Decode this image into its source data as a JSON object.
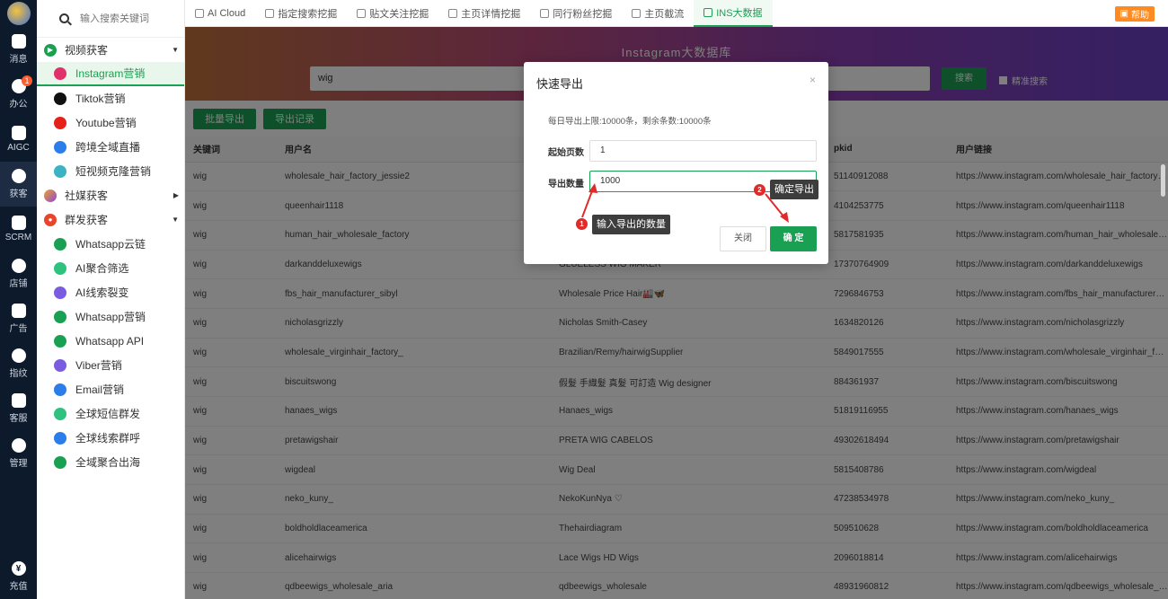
{
  "rail": {
    "badge": "1",
    "items": [
      {
        "label": "消息",
        "icon": "chat-icon"
      },
      {
        "label": "办公",
        "icon": "office-icon"
      },
      {
        "label": "AIGC",
        "icon": "aigc-icon"
      },
      {
        "label": "获客",
        "icon": "user-acquire-icon"
      },
      {
        "label": "SCRM",
        "icon": "scrm-icon"
      },
      {
        "label": "店铺",
        "icon": "store-icon"
      },
      {
        "label": "广告",
        "icon": "ads-icon"
      },
      {
        "label": "指纹",
        "icon": "fingerprint-icon"
      },
      {
        "label": "客服",
        "icon": "service-icon"
      },
      {
        "label": "管理",
        "icon": "grid-icon"
      }
    ],
    "bottom": {
      "label": "充值",
      "icon": "recharge-icon"
    }
  },
  "sidebar": {
    "search_placeholder": "输入搜索关键词",
    "group_video": "视频获客",
    "group_social": "社媒获客",
    "group_mass": "群发获客",
    "video_items": [
      "Instagram营销",
      "Tiktok营销",
      "Youtube营销",
      "跨境全域直播",
      "短视频克隆营销"
    ],
    "mass_items": [
      "Whatsapp云链",
      "AI聚合筛选",
      "AI线索裂变",
      "Whatsapp营销",
      "Whatsapp API",
      "Viber营销",
      "Email营销",
      "全球短信群发",
      "全球线索群呼",
      "全域聚合出海"
    ]
  },
  "tabs": [
    "AI Cloud",
    "指定搜索挖掘",
    "贴文关注挖掘",
    "主页详情挖掘",
    "同行粉丝挖掘",
    "主页截流",
    "INS大数据"
  ],
  "help_label": "帮助",
  "banner": {
    "title": "Instagram大数据库",
    "search_value": "wig",
    "search_button": "搜索",
    "precise_label": "精准搜索"
  },
  "actions": {
    "batch_export": "批量导出",
    "export_records": "导出记录"
  },
  "table": {
    "headers": [
      "关键词",
      "用户名",
      "",
      "pkid",
      "用户链接"
    ],
    "rows": [
      [
        "wig",
        "wholesale_hair_factory_jessie2",
        "",
        "51140912088",
        "https://www.instagram.com/wholesale_hair_factory…"
      ],
      [
        "wig",
        "queenhair1118",
        "",
        "4104253775",
        "https://www.instagram.com/queenhair1118"
      ],
      [
        "wig",
        "human_hair_wholesale_factory",
        "",
        "5817581935",
        "https://www.instagram.com/human_hair_wholesale…"
      ],
      [
        "wig",
        "darkanddeluxewigs",
        "GLUELESS WIG MAKER",
        "17370764909",
        "https://www.instagram.com/darkanddeluxewigs"
      ],
      [
        "wig",
        "fbs_hair_manufacturer_sibyl",
        "Wholesale Price Hair🏭🦋",
        "7296846753",
        "https://www.instagram.com/fbs_hair_manufacturer…"
      ],
      [
        "wig",
        "nicholasgrizzly",
        "Nicholas Smith-Casey",
        "1634820126",
        "https://www.instagram.com/nicholasgrizzly"
      ],
      [
        "wig",
        "wholesale_virginhair_factory_",
        "Brazilian/Remy/hairwigSupplier",
        "5849017555",
        "https://www.instagram.com/wholesale_virginhair_f…"
      ],
      [
        "wig",
        "biscuitswong",
        "假髮 手織髮 真髮 可訂造 Wig designer",
        "884361937",
        "https://www.instagram.com/biscuitswong"
      ],
      [
        "wig",
        "hanaes_wigs",
        "Hanaes_wigs",
        "51819116955",
        "https://www.instagram.com/hanaes_wigs"
      ],
      [
        "wig",
        "pretawigshair",
        "PRETA WIG CABELOS",
        "49302618494",
        "https://www.instagram.com/pretawigshair"
      ],
      [
        "wig",
        "wigdeal",
        "Wig Deal",
        "5815408786",
        "https://www.instagram.com/wigdeal"
      ],
      [
        "wig",
        "neko_kuny_",
        "NekoKunNya ♡",
        "47238534978",
        "https://www.instagram.com/neko_kuny_"
      ],
      [
        "wig",
        "boldholdlaceamerica",
        "Thehairdiagram",
        "509510628",
        "https://www.instagram.com/boldholdlaceamerica"
      ],
      [
        "wig",
        "alicehairwigs",
        "Lace Wigs HD Wigs",
        "2096018814",
        "https://www.instagram.com/alicehairwigs"
      ],
      [
        "wig",
        "qdbeewigs_wholesale_aria",
        "qdbeewigs_wholesale",
        "48931960812",
        "https://www.instagram.com/qdbeewigs_wholesale_…"
      ]
    ]
  },
  "modal": {
    "title": "快速导出",
    "close_icon": "×",
    "desc": "每日导出上限:10000条，剩余条数:10000条",
    "start_label": "起始页数",
    "start_value": "1",
    "count_label": "导出数量",
    "count_value": "1000",
    "btn_close": "关闭",
    "btn_ok": "确 定"
  },
  "annotations": {
    "step1_num": "1",
    "step1_text": "输入导出的数量",
    "step2_num": "2",
    "step2_text": "确定导出"
  }
}
